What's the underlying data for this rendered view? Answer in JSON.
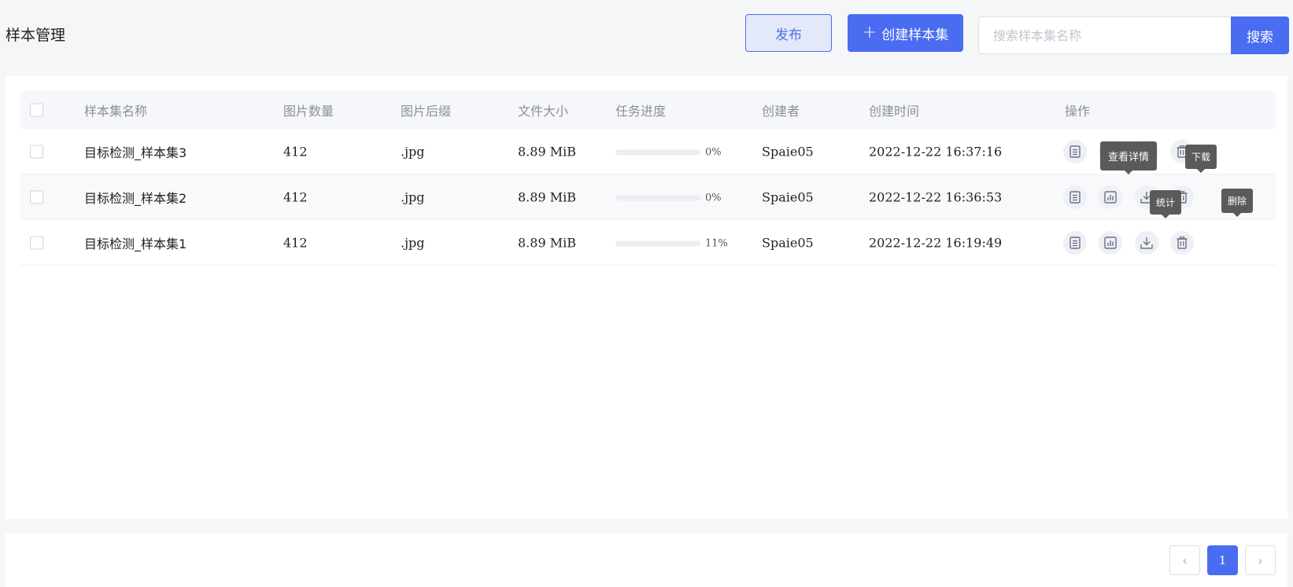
{
  "page_title": "样本管理",
  "toolbar": {
    "publish_label": "发布",
    "create_label": "创建样本集",
    "search_placeholder": "搜索样本集名称",
    "search_value": "",
    "search_label": "搜索"
  },
  "table": {
    "headers": [
      "样本集名称",
      "图片数量",
      "图片后缀",
      "文件大小",
      "任务进度",
      "创建者",
      "创建时间",
      "操作"
    ],
    "rows": [
      {
        "name": "目标检测_样本集3",
        "count": "412",
        "suffix": ".jpg",
        "size": "8.89 MiB",
        "progress": 0,
        "progress_text": "0%",
        "creator": "Spaie05",
        "created": "2022-12-22 16:37:16"
      },
      {
        "name": "目标检测_样本集2",
        "count": "412",
        "suffix": ".jpg",
        "size": "8.89 MiB",
        "progress": 0,
        "progress_text": "0%",
        "creator": "Spaie05",
        "created": "2022-12-22 16:36:53"
      },
      {
        "name": "目标检测_样本集1",
        "count": "412",
        "suffix": ".jpg",
        "size": "8.89 MiB",
        "progress": 0.11,
        "progress_text": "11%",
        "creator": "Spaie05",
        "created": "2022-12-22 16:19:49"
      }
    ]
  },
  "tooltips": {
    "detail": "查看详情",
    "download": "下载",
    "stats": "统计",
    "delete": "删除"
  },
  "pagination": {
    "current_page": "1",
    "prev_icon": "chevron-left-icon",
    "next_icon": "chevron-right-icon"
  },
  "colors": {
    "accent": "#4a6cf0",
    "tooltip_bg": "#5a5a5a"
  }
}
